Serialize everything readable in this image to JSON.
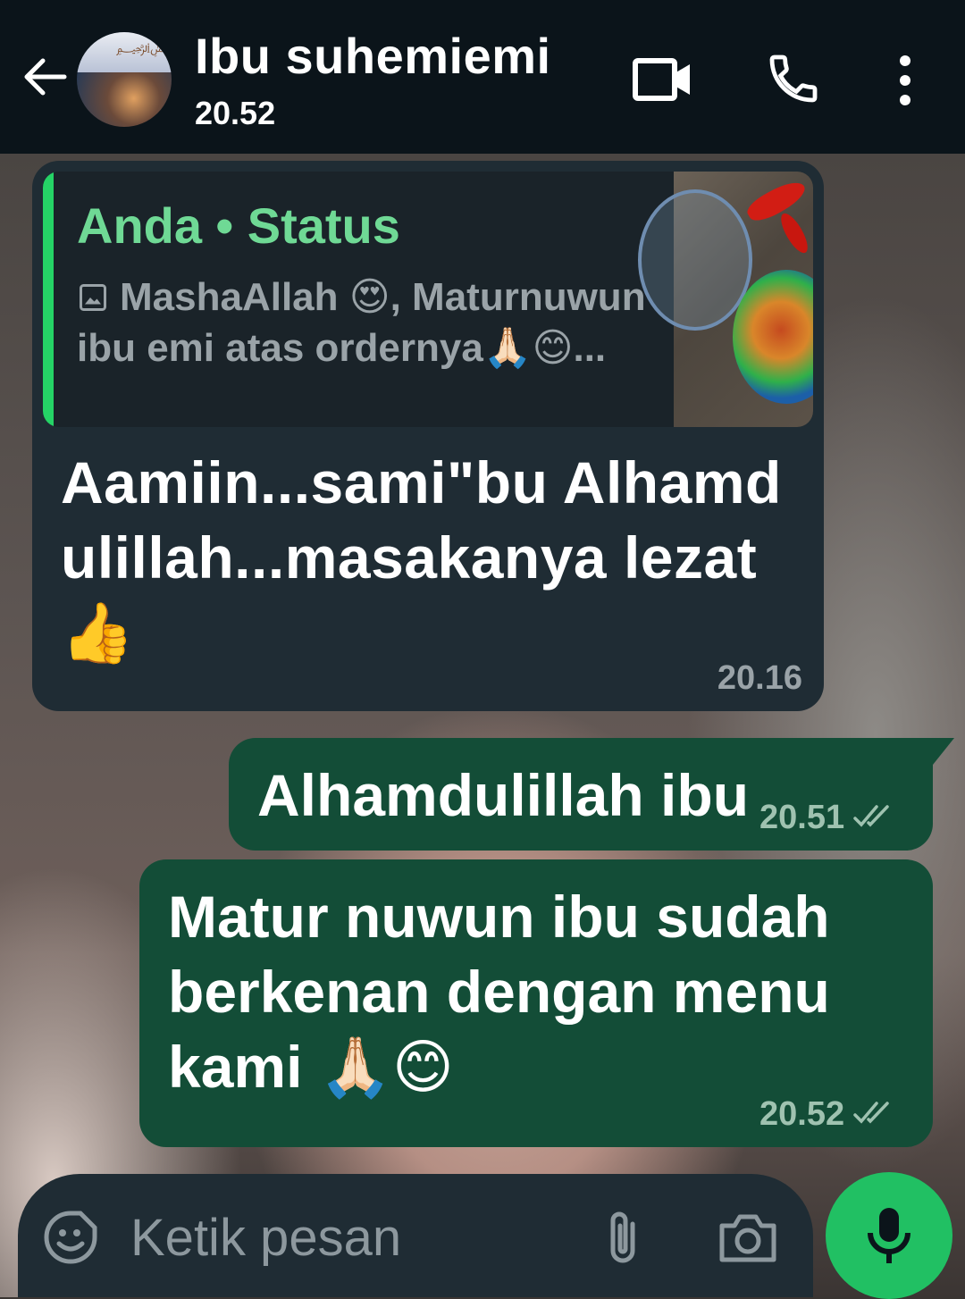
{
  "header": {
    "contact_name": "Ibu suhemiemi",
    "contact_status": "20.52",
    "icons": {
      "back": "arrow-left-icon",
      "video": "video-camera-icon",
      "call": "phone-icon",
      "menu": "more-vertical-icon"
    }
  },
  "messages": [
    {
      "direction": "incoming",
      "quote": {
        "author": "Anda • Status",
        "icon": "image-icon",
        "text": "MashaAllah 😍, Maturnuwun ibu emi atas ordernya🙏🏻😊..."
      },
      "text": "Aamiin...sami\"bu Alhamd ulillah...masakanya lezat",
      "emoji": "👍",
      "time": "20.16"
    },
    {
      "direction": "outgoing",
      "text": "Alhamdulillah ibu",
      "time": "20.51",
      "read_status": "double-check-icon"
    },
    {
      "direction": "outgoing",
      "text": "Matur nuwun ibu sudah berkenan dengan menu kami",
      "emoji": "🙏🏻😊",
      "time": "20.52",
      "read_status": "double-check-icon"
    }
  ],
  "composer": {
    "placeholder": "Ketik pesan",
    "value": "",
    "icons": {
      "emoji": "sticker-icon",
      "attach": "paperclip-icon",
      "camera": "camera-icon",
      "mic": "microphone-icon"
    }
  },
  "colors": {
    "header_bg": "#0b141a",
    "incoming_bubble": "#1f2c34",
    "outgoing_bubble": "#134d37",
    "quote_accent": "#25d366",
    "quote_author": "#6fd995",
    "mic_button": "#21c063"
  }
}
